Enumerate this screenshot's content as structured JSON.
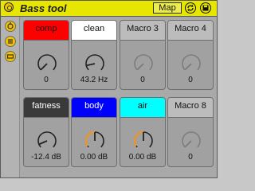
{
  "title": "Bass tool",
  "map_label": "Map",
  "macros": [
    {
      "label": "comp",
      "value": "0",
      "color": "#ff0000",
      "text_color": "#111111",
      "active": true,
      "level": 0.0
    },
    {
      "label": "clean",
      "value": "43.2 Hz",
      "color": "#ffffff",
      "text_color": "#111111",
      "active": true,
      "level": 0.12
    },
    {
      "label": "Macro 3",
      "value": "0",
      "color": "#bcbcbc",
      "text_color": "#111111",
      "active": false,
      "level": 0.0
    },
    {
      "label": "Macro 4",
      "value": "0",
      "color": "#bcbcbc",
      "text_color": "#111111",
      "active": false,
      "level": 0.0
    },
    {
      "label": "fatness",
      "value": "-12.4 dB",
      "color": "#3a3a3a",
      "text_color": "#ffffff",
      "active": true,
      "level": 0.08
    },
    {
      "label": "body",
      "value": "0.00 dB",
      "color": "#0000ff",
      "text_color": "#ffffff",
      "active": true,
      "level": 0.5
    },
    {
      "label": "air",
      "value": "0.00 dB",
      "color": "#00ffff",
      "text_color": "#111111",
      "active": true,
      "level": 0.5
    },
    {
      "label": "Macro 8",
      "value": "0",
      "color": "#bcbcbc",
      "text_color": "#111111",
      "active": false,
      "level": 0.0
    }
  ],
  "icons": {
    "power": "power-icon",
    "hotswap": "hot-swap-icon",
    "save": "save-preset-icon",
    "side1": "show-chains-icon",
    "side2": "show-macros-icon",
    "side3": "show-devices-icon"
  },
  "colors": {
    "accent": "#e7e600",
    "orange_arc": "#f39420"
  }
}
